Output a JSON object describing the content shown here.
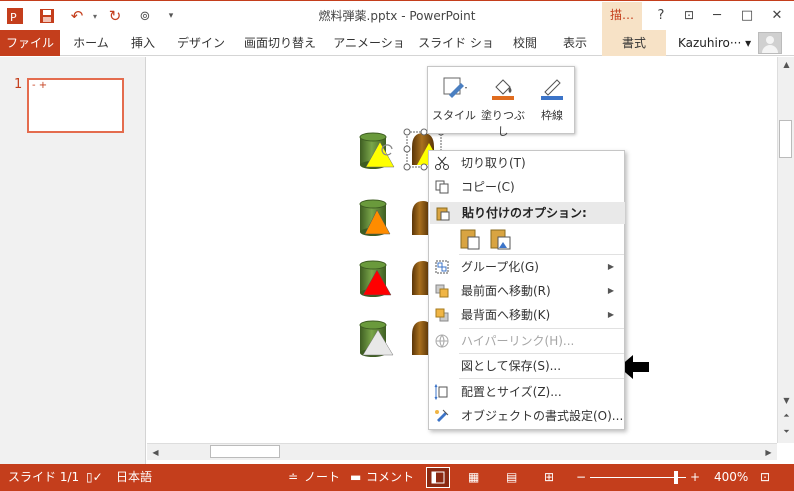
{
  "window": {
    "title": "燃料弾薬.pptx - PowerPoint",
    "context_label": "描画ツール",
    "context_label_short": "描…",
    "help": "?",
    "min": "─",
    "max": "□",
    "close": "✕"
  },
  "ribbon": {
    "tabs": [
      "ファイル",
      "ホーム",
      "挿入",
      "デザイン",
      "画面切り替え",
      "アニメーション",
      "スライド ショー",
      "校閲",
      "表示",
      "書式"
    ],
    "user": "Kazuhiro··· ▾"
  },
  "thumbs": {
    "number": "1"
  },
  "minitoolbar": {
    "style": "スタイル",
    "fill": "塗りつぶし",
    "outline": "枠線"
  },
  "contextmenu": {
    "cut": "切り取り(T)",
    "copy": "コピー(C)",
    "paste_header": "貼り付けのオプション:",
    "group": "グループ化(G)",
    "bring_front": "最前面へ移動(R)",
    "send_back": "最背面へ移動(K)",
    "hyperlink": "ハイパーリンク(H)...",
    "save_as_picture": "図として保存(S)...",
    "size_position": "配置とサイズ(Z)...",
    "format_object": "オブジェクトの書式設定(O)..."
  },
  "status": {
    "slide": "スライド 1/1",
    "language": "日本語",
    "notes": "ノート",
    "comments": "コメント",
    "zoom": "400%"
  },
  "colors": {
    "accent": "#c43e1c",
    "context": "#f7e2c6"
  }
}
